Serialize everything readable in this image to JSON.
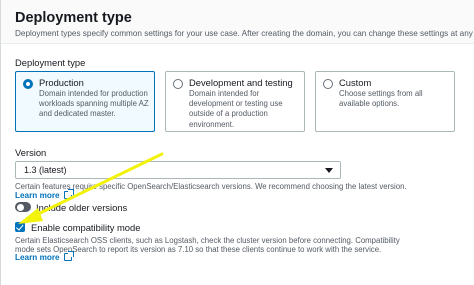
{
  "section": {
    "title": "Deployment type",
    "description": "Deployment types specify common settings for your use case. After creating the domain, you can change these settings at any time."
  },
  "deployment": {
    "label": "Deployment type",
    "options": [
      {
        "title": "Production",
        "description": "Domain intended for production workloads spanning multiple AZ and dedicated master.",
        "selected": true
      },
      {
        "title": "Development and testing",
        "description": "Domain intended for development or testing use outside of a production environment.",
        "selected": false
      },
      {
        "title": "Custom",
        "description": "Choose settings from all available options.",
        "selected": false
      }
    ]
  },
  "version": {
    "label": "Version",
    "selected": "1.3 (latest)",
    "hint": "Certain features require specific OpenSearch/Elasticsearch versions. We recommend choosing the latest version.",
    "learn_more": "Learn more",
    "include_older_label": "Include older versions",
    "include_older_enabled": false
  },
  "compat": {
    "label": "Enable compatibility mode",
    "checked": true,
    "hint_line1": "Certain Elasticsearch OSS clients, such as Logstash, check the cluster version before connecting. Compatibility",
    "hint_line2": "mode sets OpenSearch to report its version as 7.10 so that these clients continue to work with the service.",
    "learn_more": "Learn more"
  },
  "colors": {
    "accent": "#0073bb",
    "annotation_arrow": "#f2f20a"
  },
  "icons": {
    "external_link": "external-link-icon",
    "dropdown": "chevron-down-icon"
  }
}
